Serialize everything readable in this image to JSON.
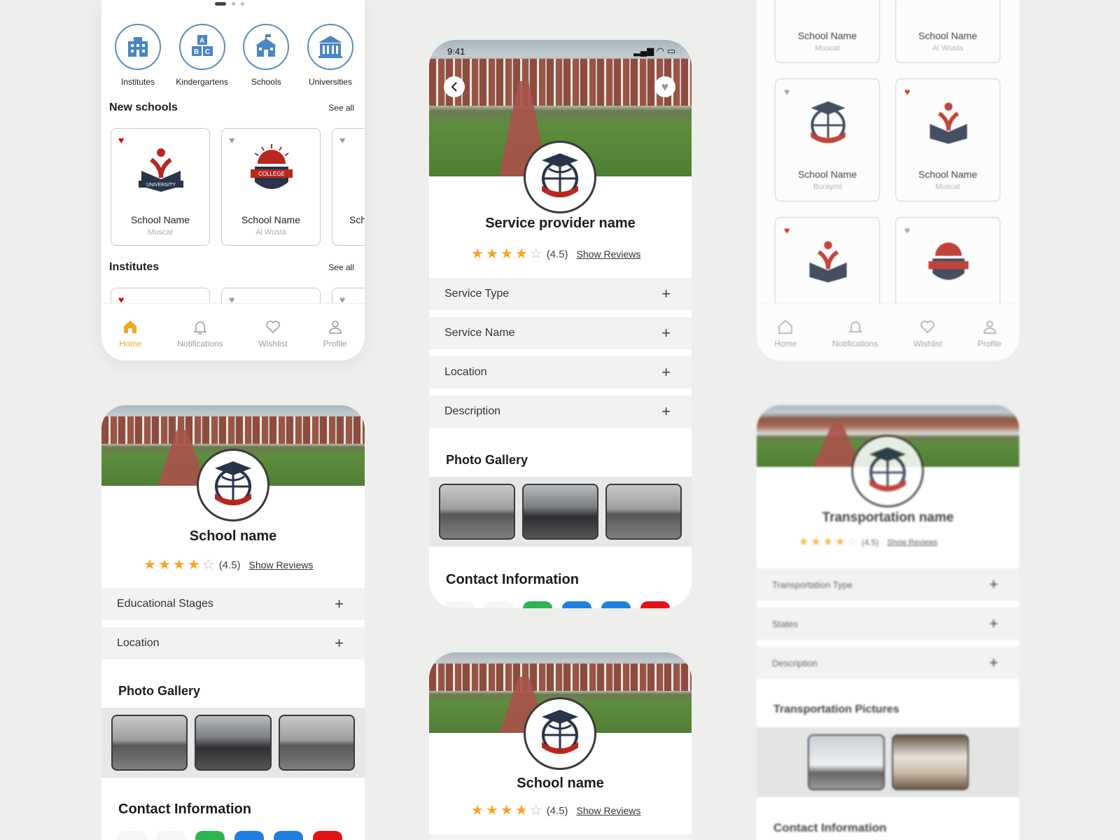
{
  "colors": {
    "accent": "#f2a81e",
    "heart_on": "#d30f0f",
    "star": "#f5a623"
  },
  "home": {
    "categories": [
      {
        "label": "Institutes",
        "icon": "institute-building-icon"
      },
      {
        "label": "Kindergartens",
        "icon": "abc-blocks-icon"
      },
      {
        "label": "Schools",
        "icon": "school-building-icon"
      },
      {
        "label": "Universities",
        "icon": "university-building-icon"
      }
    ],
    "new_schools_title": "New schools",
    "new_schools_see_all": "See all",
    "cards": [
      {
        "name": "School Name",
        "loc": "Muscat",
        "fav": true
      },
      {
        "name": "School Name",
        "loc": "Al Wusta",
        "fav": false
      },
      {
        "name": "Sch",
        "loc": "",
        "fav": false
      }
    ],
    "institutes_title": "Institutes",
    "institutes_see_all": "See all",
    "nav": [
      {
        "label": "Home",
        "icon": "home-icon",
        "active": true
      },
      {
        "label": "Notifications",
        "icon": "bell-icon",
        "active": false
      },
      {
        "label": "Wishlist",
        "icon": "heart-icon",
        "active": false
      },
      {
        "label": "Profile",
        "icon": "user-icon",
        "active": false
      }
    ]
  },
  "service": {
    "time": "9:41",
    "title": "Service provider name",
    "rating": "(4.5)",
    "stars": 4,
    "reviews": "Show Reviews",
    "sections": [
      "Service Type",
      "Service Name",
      "Location",
      "Description"
    ],
    "gallery_title": "Photo Gallery",
    "contact_title": "Contact Information"
  },
  "grid": {
    "cards": [
      {
        "name": "School Name",
        "loc": "Muscat"
      },
      {
        "name": "School Name",
        "loc": "Al Wusta"
      },
      {
        "name": "School Name",
        "loc": "Burayml",
        "fav": false
      },
      {
        "name": "School Name",
        "loc": "Muscat",
        "fav": true
      },
      {
        "fav": true
      },
      {
        "fav": false
      }
    ],
    "nav": [
      "Home",
      "Notifications",
      "Wishlist",
      "Profile"
    ]
  },
  "school": {
    "title": "School name",
    "rating": "(4.5)",
    "stars": 4,
    "reviews": "Show Reviews",
    "sections": [
      "Educational Stages",
      "Location"
    ],
    "gallery_title": "Photo Gallery",
    "contact_title": "Contact Information"
  },
  "school2": {
    "title": "School name",
    "rating": "(4.5)",
    "stars": 4,
    "reviews": "Show Reviews"
  },
  "transport": {
    "title": "Transportation name",
    "rating": "(4.5)",
    "stars": 4,
    "reviews": "Show Reviews",
    "sections": [
      "Transportation Type",
      "States",
      "Description"
    ],
    "pictures_title": "Transportation Pictures",
    "contact_title": "Contact Information"
  }
}
